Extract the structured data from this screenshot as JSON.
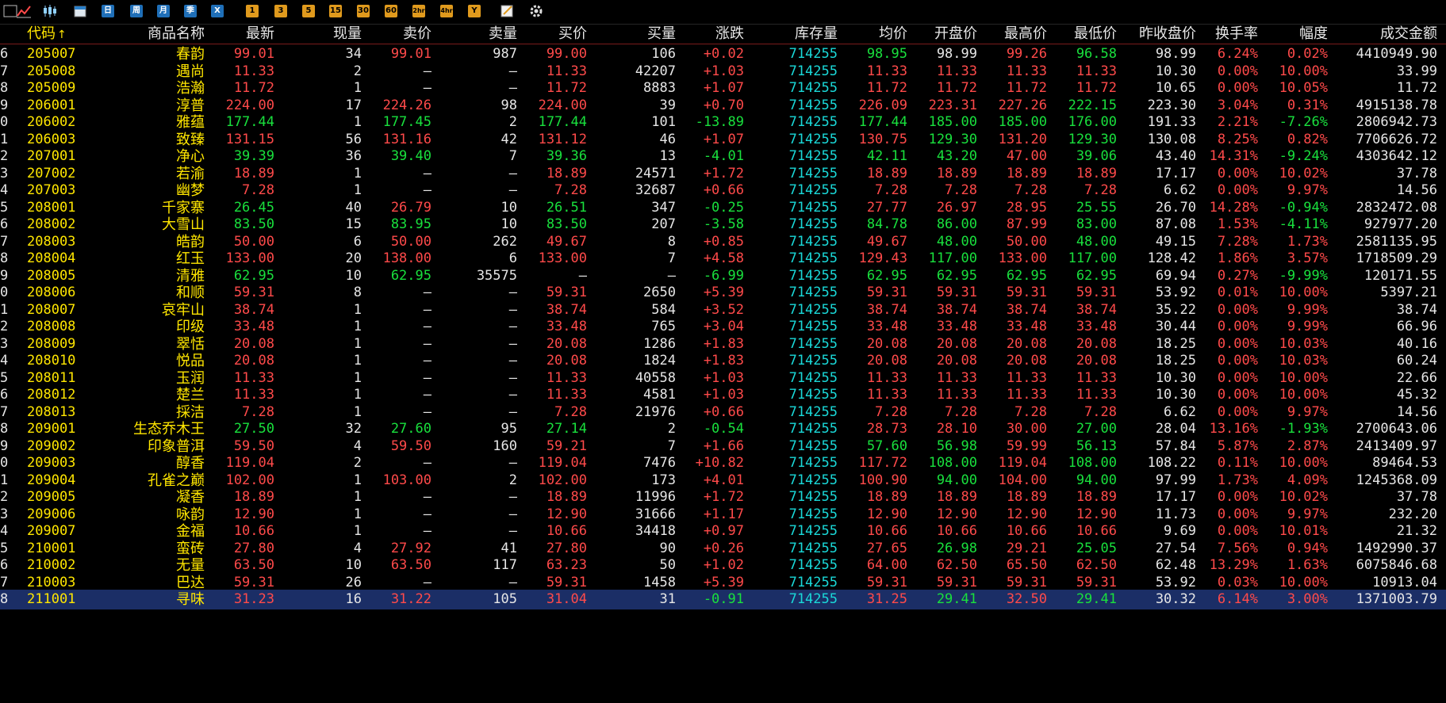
{
  "colors": {
    "up": "#ff4a4a",
    "down": "#19e03d",
    "flat": "#e6e6e6",
    "name": "#ffe600",
    "stock": "#1ad8d8",
    "selected_row_bg": "#1b2e66"
  },
  "toolbar": {
    "items": [
      {
        "name": "list-view-icon",
        "label": ""
      },
      {
        "name": "line-chart-icon",
        "label": ""
      },
      {
        "name": "candlestick-icon",
        "label": ""
      },
      {
        "name": "calendar-icon",
        "label": ""
      },
      {
        "name": "period-day-button",
        "label": "日"
      },
      {
        "name": "period-week-button",
        "label": "周"
      },
      {
        "name": "period-month-button",
        "label": "月"
      },
      {
        "name": "period-quarter-button",
        "label": "季"
      },
      {
        "name": "period-close-button",
        "label": "X"
      },
      {
        "name": "period-1min-button",
        "label": "1"
      },
      {
        "name": "period-3min-button",
        "label": "3"
      },
      {
        "name": "period-5min-button",
        "label": "5"
      },
      {
        "name": "period-15min-button",
        "label": "15"
      },
      {
        "name": "period-30min-button",
        "label": "30"
      },
      {
        "name": "period-60min-button",
        "label": "60"
      },
      {
        "name": "period-2h-button",
        "label": "2hr"
      },
      {
        "name": "period-4h-button",
        "label": "4hr"
      },
      {
        "name": "period-year-button",
        "label": "Y"
      },
      {
        "name": "draw-tool-icon",
        "label": ""
      },
      {
        "name": "settings-gear-icon",
        "label": ""
      }
    ]
  },
  "headers": [
    {
      "key": "idx",
      "label": ""
    },
    {
      "key": "code",
      "label": "代码",
      "sort": "↑"
    },
    {
      "key": "name",
      "label": "商品名称"
    },
    {
      "key": "last",
      "label": "最新"
    },
    {
      "key": "vol",
      "label": "现量"
    },
    {
      "key": "ask",
      "label": "卖价"
    },
    {
      "key": "askv",
      "label": "卖量"
    },
    {
      "key": "bid",
      "label": "买价"
    },
    {
      "key": "bidv",
      "label": "买量"
    },
    {
      "key": "chg",
      "label": "涨跌"
    },
    {
      "key": "stock",
      "label": "库存量"
    },
    {
      "key": "avg",
      "label": "均价"
    },
    {
      "key": "open",
      "label": "开盘价"
    },
    {
      "key": "high",
      "label": "最高价"
    },
    {
      "key": "low",
      "label": "最低价"
    },
    {
      "key": "prev",
      "label": "昨收盘价"
    },
    {
      "key": "turn",
      "label": "换手率"
    },
    {
      "key": "amp",
      "label": "幅度"
    },
    {
      "key": "amt",
      "label": "成交金额"
    }
  ],
  "rows": [
    {
      "idx": "6",
      "code": "205007",
      "name": "春韵",
      "last": "99.01",
      "vol": "34",
      "ask": "99.01",
      "askv": "987",
      "bid": "99.00",
      "bidv": "106",
      "chg": "+0.02",
      "stock": "714255",
      "avg": "98.95",
      "open": "98.99",
      "high": "99.26",
      "low": "96.58",
      "prev": "98.99",
      "turn": "6.24%",
      "amp": "0.02%",
      "amt": "4410949.90"
    },
    {
      "idx": "7",
      "code": "205008",
      "name": "遇尚",
      "last": "11.33",
      "vol": "2",
      "ask": "—",
      "askv": "—",
      "bid": "11.33",
      "bidv": "42207",
      "chg": "+1.03",
      "stock": "714255",
      "avg": "11.33",
      "open": "11.33",
      "high": "11.33",
      "low": "11.33",
      "prev": "10.30",
      "turn": "0.00%",
      "amp": "10.00%",
      "amt": "33.99"
    },
    {
      "idx": "8",
      "code": "205009",
      "name": "浩瀚",
      "last": "11.72",
      "vol": "1",
      "ask": "—",
      "askv": "—",
      "bid": "11.72",
      "bidv": "8883",
      "chg": "+1.07",
      "stock": "714255",
      "avg": "11.72",
      "open": "11.72",
      "high": "11.72",
      "low": "11.72",
      "prev": "10.65",
      "turn": "0.00%",
      "amp": "10.05%",
      "amt": "11.72"
    },
    {
      "idx": "9",
      "code": "206001",
      "name": "淳普",
      "last": "224.00",
      "vol": "17",
      "ask": "224.26",
      "askv": "98",
      "bid": "224.00",
      "bidv": "39",
      "chg": "+0.70",
      "stock": "714255",
      "avg": "226.09",
      "open": "223.31",
      "high": "227.26",
      "low": "222.15",
      "prev": "223.30",
      "turn": "3.04%",
      "amp": "0.31%",
      "amt": "4915138.78"
    },
    {
      "idx": "0",
      "code": "206002",
      "name": "雅蕴",
      "last": "177.44",
      "vol": "1",
      "ask": "177.45",
      "askv": "2",
      "bid": "177.44",
      "bidv": "101",
      "chg": "-13.89",
      "stock": "714255",
      "avg": "177.44",
      "open": "185.00",
      "high": "185.00",
      "low": "176.00",
      "prev": "191.33",
      "turn": "2.21%",
      "amp": "-7.26%",
      "amt": "2806942.73"
    },
    {
      "idx": "1",
      "code": "206003",
      "name": "致臻",
      "last": "131.15",
      "vol": "56",
      "ask": "131.16",
      "askv": "42",
      "bid": "131.12",
      "bidv": "46",
      "chg": "+1.07",
      "stock": "714255",
      "avg": "130.75",
      "open": "129.30",
      "high": "131.20",
      "low": "129.30",
      "prev": "130.08",
      "turn": "8.25%",
      "amp": "0.82%",
      "amt": "7706626.72"
    },
    {
      "idx": "2",
      "code": "207001",
      "name": "净心",
      "last": "39.39",
      "vol": "36",
      "ask": "39.40",
      "askv": "7",
      "bid": "39.36",
      "bidv": "13",
      "chg": "-4.01",
      "stock": "714255",
      "avg": "42.11",
      "open": "43.20",
      "high": "47.00",
      "low": "39.06",
      "prev": "43.40",
      "turn": "14.31%",
      "amp": "-9.24%",
      "amt": "4303642.12"
    },
    {
      "idx": "3",
      "code": "207002",
      "name": "若渝",
      "last": "18.89",
      "vol": "1",
      "ask": "—",
      "askv": "—",
      "bid": "18.89",
      "bidv": "24571",
      "chg": "+1.72",
      "stock": "714255",
      "avg": "18.89",
      "open": "18.89",
      "high": "18.89",
      "low": "18.89",
      "prev": "17.17",
      "turn": "0.00%",
      "amp": "10.02%",
      "amt": "37.78"
    },
    {
      "idx": "4",
      "code": "207003",
      "name": "幽梦",
      "last": "7.28",
      "vol": "1",
      "ask": "—",
      "askv": "—",
      "bid": "7.28",
      "bidv": "32687",
      "chg": "+0.66",
      "stock": "714255",
      "avg": "7.28",
      "open": "7.28",
      "high": "7.28",
      "low": "7.28",
      "prev": "6.62",
      "turn": "0.00%",
      "amp": "9.97%",
      "amt": "14.56"
    },
    {
      "idx": "5",
      "code": "208001",
      "name": "千家寨",
      "last": "26.45",
      "vol": "40",
      "ask": "26.79",
      "askv": "10",
      "bid": "26.51",
      "bidv": "347",
      "chg": "-0.25",
      "stock": "714255",
      "avg": "27.77",
      "open": "26.97",
      "high": "28.95",
      "low": "25.55",
      "prev": "26.70",
      "turn": "14.28%",
      "amp": "-0.94%",
      "amt": "2832472.08"
    },
    {
      "idx": "6",
      "code": "208002",
      "name": "大雪山",
      "last": "83.50",
      "vol": "15",
      "ask": "83.95",
      "askv": "10",
      "bid": "83.50",
      "bidv": "207",
      "chg": "-3.58",
      "stock": "714255",
      "avg": "84.78",
      "open": "86.00",
      "high": "87.99",
      "low": "83.00",
      "prev": "87.08",
      "turn": "1.53%",
      "amp": "-4.11%",
      "amt": "927977.20"
    },
    {
      "idx": "7",
      "code": "208003",
      "name": "皓韵",
      "last": "50.00",
      "vol": "6",
      "ask": "50.00",
      "askv": "262",
      "bid": "49.67",
      "bidv": "8",
      "chg": "+0.85",
      "stock": "714255",
      "avg": "49.67",
      "open": "48.00",
      "high": "50.00",
      "low": "48.00",
      "prev": "49.15",
      "turn": "7.28%",
      "amp": "1.73%",
      "amt": "2581135.95"
    },
    {
      "idx": "8",
      "code": "208004",
      "name": "红玉",
      "last": "133.00",
      "vol": "20",
      "ask": "138.00",
      "askv": "6",
      "bid": "133.00",
      "bidv": "7",
      "chg": "+4.58",
      "stock": "714255",
      "avg": "129.43",
      "open": "117.00",
      "high": "133.00",
      "low": "117.00",
      "prev": "128.42",
      "turn": "1.86%",
      "amp": "3.57%",
      "amt": "1718509.29"
    },
    {
      "idx": "9",
      "code": "208005",
      "name": "清雅",
      "last": "62.95",
      "vol": "10",
      "ask": "62.95",
      "askv": "35575",
      "bid": "—",
      "bidv": "—",
      "chg": "-6.99",
      "stock": "714255",
      "avg": "62.95",
      "open": "62.95",
      "high": "62.95",
      "low": "62.95",
      "prev": "69.94",
      "turn": "0.27%",
      "amp": "-9.99%",
      "amt": "120171.55"
    },
    {
      "idx": "0",
      "code": "208006",
      "name": "和顺",
      "last": "59.31",
      "vol": "8",
      "ask": "—",
      "askv": "—",
      "bid": "59.31",
      "bidv": "2650",
      "chg": "+5.39",
      "stock": "714255",
      "avg": "59.31",
      "open": "59.31",
      "high": "59.31",
      "low": "59.31",
      "prev": "53.92",
      "turn": "0.01%",
      "amp": "10.00%",
      "amt": "5397.21"
    },
    {
      "idx": "1",
      "code": "208007",
      "name": "哀牢山",
      "last": "38.74",
      "vol": "1",
      "ask": "—",
      "askv": "—",
      "bid": "38.74",
      "bidv": "584",
      "chg": "+3.52",
      "stock": "714255",
      "avg": "38.74",
      "open": "38.74",
      "high": "38.74",
      "low": "38.74",
      "prev": "35.22",
      "turn": "0.00%",
      "amp": "9.99%",
      "amt": "38.74"
    },
    {
      "idx": "2",
      "code": "208008",
      "name": "印级",
      "last": "33.48",
      "vol": "1",
      "ask": "—",
      "askv": "—",
      "bid": "33.48",
      "bidv": "765",
      "chg": "+3.04",
      "stock": "714255",
      "avg": "33.48",
      "open": "33.48",
      "high": "33.48",
      "low": "33.48",
      "prev": "30.44",
      "turn": "0.00%",
      "amp": "9.99%",
      "amt": "66.96"
    },
    {
      "idx": "3",
      "code": "208009",
      "name": "翠恬",
      "last": "20.08",
      "vol": "1",
      "ask": "—",
      "askv": "—",
      "bid": "20.08",
      "bidv": "1286",
      "chg": "+1.83",
      "stock": "714255",
      "avg": "20.08",
      "open": "20.08",
      "high": "20.08",
      "low": "20.08",
      "prev": "18.25",
      "turn": "0.00%",
      "amp": "10.03%",
      "amt": "40.16"
    },
    {
      "idx": "4",
      "code": "208010",
      "name": "悦品",
      "last": "20.08",
      "vol": "1",
      "ask": "—",
      "askv": "—",
      "bid": "20.08",
      "bidv": "1824",
      "chg": "+1.83",
      "stock": "714255",
      "avg": "20.08",
      "open": "20.08",
      "high": "20.08",
      "low": "20.08",
      "prev": "18.25",
      "turn": "0.00%",
      "amp": "10.03%",
      "amt": "60.24"
    },
    {
      "idx": "5",
      "code": "208011",
      "name": "玉润",
      "last": "11.33",
      "vol": "1",
      "ask": "—",
      "askv": "—",
      "bid": "11.33",
      "bidv": "40558",
      "chg": "+1.03",
      "stock": "714255",
      "avg": "11.33",
      "open": "11.33",
      "high": "11.33",
      "low": "11.33",
      "prev": "10.30",
      "turn": "0.00%",
      "amp": "10.00%",
      "amt": "22.66"
    },
    {
      "idx": "6",
      "code": "208012",
      "name": "楚兰",
      "last": "11.33",
      "vol": "1",
      "ask": "—",
      "askv": "—",
      "bid": "11.33",
      "bidv": "4581",
      "chg": "+1.03",
      "stock": "714255",
      "avg": "11.33",
      "open": "11.33",
      "high": "11.33",
      "low": "11.33",
      "prev": "10.30",
      "turn": "0.00%",
      "amp": "10.00%",
      "amt": "45.32"
    },
    {
      "idx": "7",
      "code": "208013",
      "name": "採洁",
      "last": "7.28",
      "vol": "1",
      "ask": "—",
      "askv": "—",
      "bid": "7.28",
      "bidv": "21976",
      "chg": "+0.66",
      "stock": "714255",
      "avg": "7.28",
      "open": "7.28",
      "high": "7.28",
      "low": "7.28",
      "prev": "6.62",
      "turn": "0.00%",
      "amp": "9.97%",
      "amt": "14.56"
    },
    {
      "idx": "8",
      "code": "209001",
      "name": "生态乔木王",
      "last": "27.50",
      "vol": "32",
      "ask": "27.60",
      "askv": "95",
      "bid": "27.14",
      "bidv": "2",
      "chg": "-0.54",
      "stock": "714255",
      "avg": "28.73",
      "open": "28.10",
      "high": "30.00",
      "low": "27.00",
      "prev": "28.04",
      "turn": "13.16%",
      "amp": "-1.93%",
      "amt": "2700643.06"
    },
    {
      "idx": "9",
      "code": "209002",
      "name": "印象普洱",
      "last": "59.50",
      "vol": "4",
      "ask": "59.50",
      "askv": "160",
      "bid": "59.21",
      "bidv": "7",
      "chg": "+1.66",
      "stock": "714255",
      "avg": "57.60",
      "open": "56.98",
      "high": "59.99",
      "low": "56.13",
      "prev": "57.84",
      "turn": "5.87%",
      "amp": "2.87%",
      "amt": "2413409.97"
    },
    {
      "idx": "0",
      "code": "209003",
      "name": "醇香",
      "last": "119.04",
      "vol": "2",
      "ask": "—",
      "askv": "—",
      "bid": "119.04",
      "bidv": "7476",
      "chg": "+10.82",
      "stock": "714255",
      "avg": "117.72",
      "open": "108.00",
      "high": "119.04",
      "low": "108.00",
      "prev": "108.22",
      "turn": "0.11%",
      "amp": "10.00%",
      "amt": "89464.53"
    },
    {
      "idx": "1",
      "code": "209004",
      "name": "孔雀之巅",
      "last": "102.00",
      "vol": "1",
      "ask": "103.00",
      "askv": "2",
      "bid": "102.00",
      "bidv": "173",
      "chg": "+4.01",
      "stock": "714255",
      "avg": "100.90",
      "open": "94.00",
      "high": "104.00",
      "low": "94.00",
      "prev": "97.99",
      "turn": "1.73%",
      "amp": "4.09%",
      "amt": "1245368.09"
    },
    {
      "idx": "2",
      "code": "209005",
      "name": "凝香",
      "last": "18.89",
      "vol": "1",
      "ask": "—",
      "askv": "—",
      "bid": "18.89",
      "bidv": "11996",
      "chg": "+1.72",
      "stock": "714255",
      "avg": "18.89",
      "open": "18.89",
      "high": "18.89",
      "low": "18.89",
      "prev": "17.17",
      "turn": "0.00%",
      "amp": "10.02%",
      "amt": "37.78"
    },
    {
      "idx": "3",
      "code": "209006",
      "name": "咏韵",
      "last": "12.90",
      "vol": "1",
      "ask": "—",
      "askv": "—",
      "bid": "12.90",
      "bidv": "31666",
      "chg": "+1.17",
      "stock": "714255",
      "avg": "12.90",
      "open": "12.90",
      "high": "12.90",
      "low": "12.90",
      "prev": "11.73",
      "turn": "0.00%",
      "amp": "9.97%",
      "amt": "232.20"
    },
    {
      "idx": "4",
      "code": "209007",
      "name": "金福",
      "last": "10.66",
      "vol": "1",
      "ask": "—",
      "askv": "—",
      "bid": "10.66",
      "bidv": "34418",
      "chg": "+0.97",
      "stock": "714255",
      "avg": "10.66",
      "open": "10.66",
      "high": "10.66",
      "low": "10.66",
      "prev": "9.69",
      "turn": "0.00%",
      "amp": "10.01%",
      "amt": "21.32"
    },
    {
      "idx": "5",
      "code": "210001",
      "name": "蛮砖",
      "last": "27.80",
      "vol": "4",
      "ask": "27.92",
      "askv": "41",
      "bid": "27.80",
      "bidv": "90",
      "chg": "+0.26",
      "stock": "714255",
      "avg": "27.65",
      "open": "26.98",
      "high": "29.21",
      "low": "25.05",
      "prev": "27.54",
      "turn": "7.56%",
      "amp": "0.94%",
      "amt": "1492990.37"
    },
    {
      "idx": "6",
      "code": "210002",
      "name": "无量",
      "last": "63.50",
      "vol": "10",
      "ask": "63.50",
      "askv": "117",
      "bid": "63.23",
      "bidv": "50",
      "chg": "+1.02",
      "stock": "714255",
      "avg": "64.00",
      "open": "62.50",
      "high": "65.50",
      "low": "62.50",
      "prev": "62.48",
      "turn": "13.29%",
      "amp": "1.63%",
      "amt": "6075846.68"
    },
    {
      "idx": "7",
      "code": "210003",
      "name": "巴达",
      "last": "59.31",
      "vol": "26",
      "ask": "—",
      "askv": "—",
      "bid": "59.31",
      "bidv": "1458",
      "chg": "+5.39",
      "stock": "714255",
      "avg": "59.31",
      "open": "59.31",
      "high": "59.31",
      "low": "59.31",
      "prev": "53.92",
      "turn": "0.03%",
      "amp": "10.00%",
      "amt": "10913.04"
    },
    {
      "idx": "8",
      "code": "211001",
      "name": "寻味",
      "last": "31.23",
      "vol": "16",
      "ask": "31.22",
      "askv": "105",
      "bid": "31.04",
      "bidv": "31",
      "chg": "-0.91",
      "stock": "714255",
      "avg": "31.25",
      "open": "29.41",
      "high": "32.50",
      "low": "29.41",
      "prev": "30.32",
      "turn": "6.14%",
      "amp": "3.00%",
      "amt": "1371003.79",
      "selected": true
    }
  ]
}
